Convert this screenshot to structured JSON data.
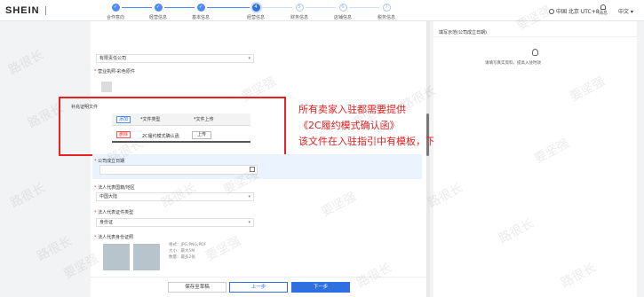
{
  "header": {
    "logo": "SHEIN",
    "timezone": "中国 北京 UTC+8",
    "notice_label": "消息",
    "language": "中文"
  },
  "steps": [
    {
      "label": "合作意向",
      "status": "done"
    },
    {
      "label": "经营信息",
      "status": "done"
    },
    {
      "label": "基本信息",
      "status": "done"
    },
    {
      "label": "经营信息",
      "status": "active",
      "num": "4"
    },
    {
      "label": "财务信息",
      "status": "todo",
      "num": "5"
    },
    {
      "label": "店铺信息",
      "status": "todo",
      "num": "6"
    },
    {
      "label": "税务信息",
      "status": "todo",
      "num": "7"
    }
  ],
  "form": {
    "company_type_value": "有限责任公司",
    "license_label": "营业执照-彩色原件",
    "performance_section_label": "补充证明文件",
    "table": {
      "add_button": "添加",
      "col_type": "*文件类型",
      "col_upload": "*文件上传",
      "delete_button": "删除",
      "row_type": "2C履约模式确认函",
      "upload_button": "上传"
    },
    "establish_date_label": "公司成立日期",
    "legal_region_label": "法人代表国籍/地区",
    "legal_region_value": "中国大陆",
    "legal_id_type_label": "法人代表证件类型",
    "legal_id_type_value": "身份证",
    "legal_id_photo_label": "法人代表身份证照",
    "photo_hint": [
      "格式：JPG,PNG,PDF",
      "大小：最大5M",
      "数量：最多2张"
    ]
  },
  "annotation": {
    "line1": "所有卖家入驻都需要提供",
    "line2": "《2C履约模式确认函》",
    "line3": "该文件在入驻指引中有模板，下载模板并填写"
  },
  "footer": {
    "save_draft": "保存至草稿",
    "prev": "上一步",
    "next": "下一步"
  },
  "side_panel": {
    "title": "填写示范(公司成立日期)",
    "hint": "请填写真实资料，提高入驻时效"
  },
  "watermark": [
    "路很长",
    "要坚强"
  ],
  "colors": {
    "primary": "#2f6fe0",
    "annotation": "#e02020"
  }
}
